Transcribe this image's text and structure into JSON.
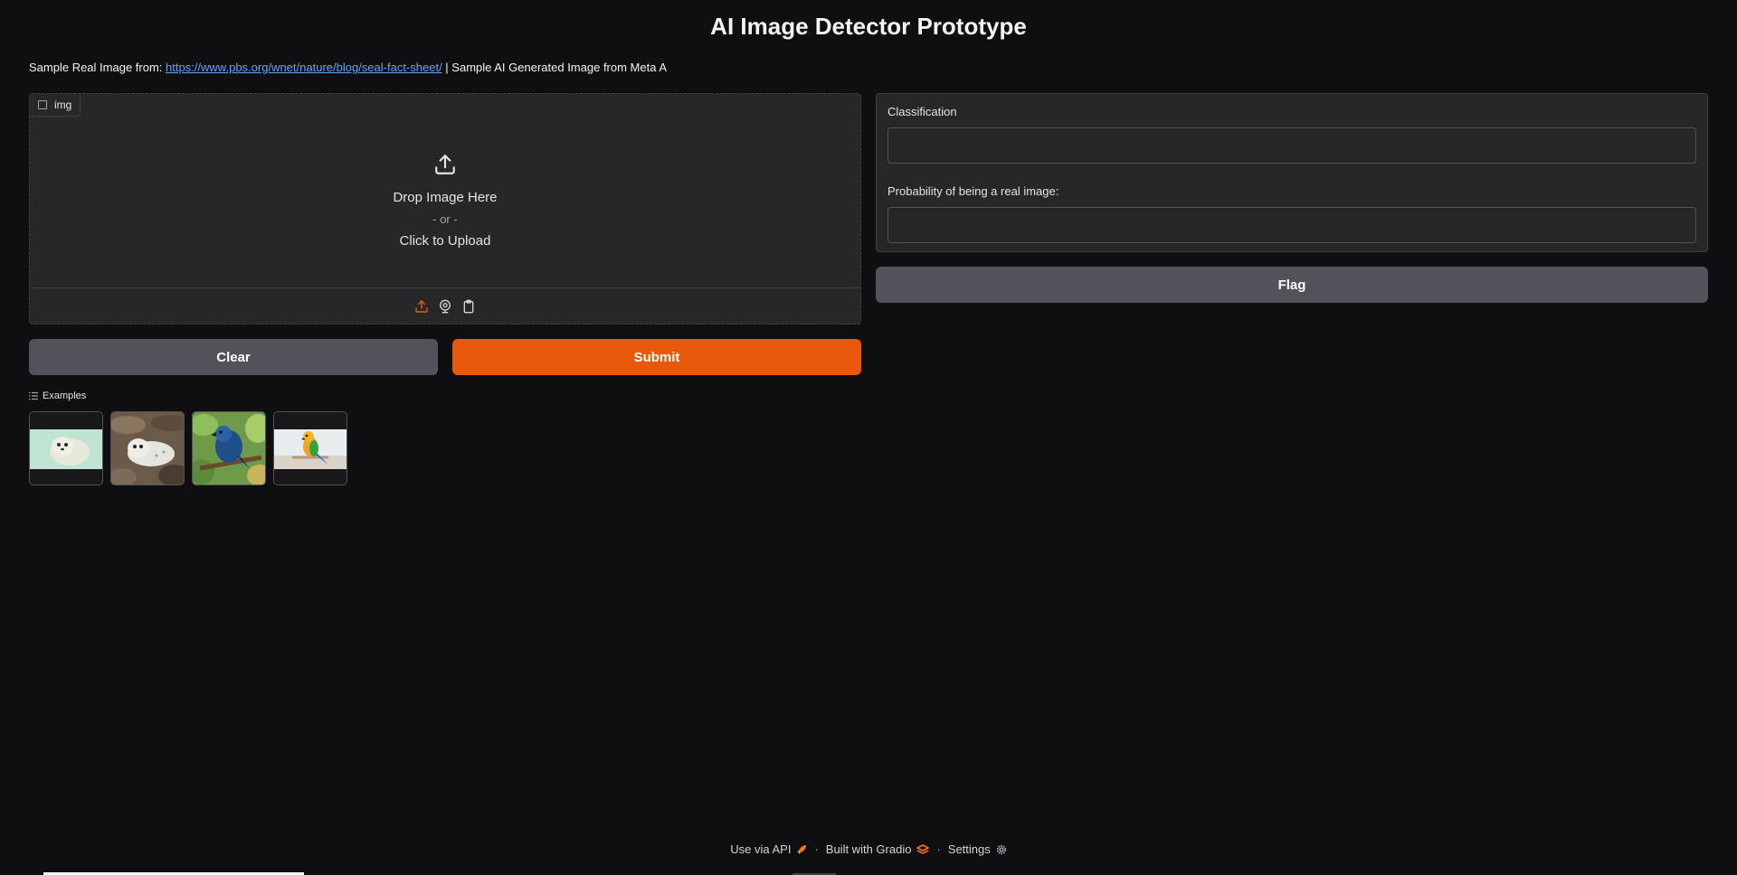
{
  "title": "AI Image Detector Prototype",
  "intro": {
    "prefix": "Sample Real Image from: ",
    "link": "https://www.pbs.org/wnet/nature/blog/seal-fact-sheet/",
    "suffix": " | Sample AI Generated Image from Meta A"
  },
  "input": {
    "label": "img",
    "drop_text": "Drop Image Here",
    "or_text": "- or -",
    "click_text": "Click to Upload",
    "sources": [
      "upload-icon",
      "webcam-icon",
      "clipboard-icon"
    ]
  },
  "buttons": {
    "clear": "Clear",
    "submit": "Submit",
    "flag": "Flag"
  },
  "examples": {
    "label": "Examples",
    "items": [
      "seal-pup-on-mint-background",
      "seal-pup-on-rocks",
      "blue-bird-on-branch",
      "parrot-on-perch"
    ]
  },
  "output": {
    "classification_label": "Classification",
    "classification_value": "",
    "probability_label": "Probability of being a real image:",
    "probability_value": ""
  },
  "footer": {
    "api": "Use via API",
    "built": "Built with Gradio",
    "settings": "Settings",
    "separator": "·"
  },
  "colors": {
    "background": "#0f0f11",
    "panel": "#27272a",
    "primary": "#ea580c",
    "secondary": "#52525b",
    "link": "#60a5fa"
  }
}
